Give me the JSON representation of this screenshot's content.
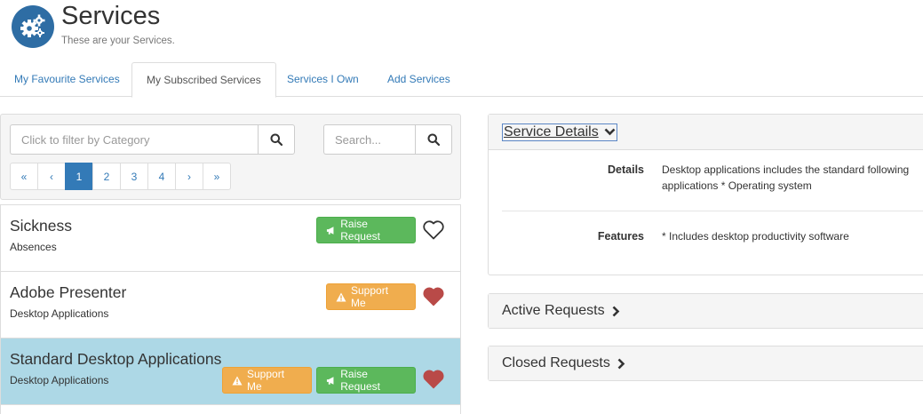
{
  "header": {
    "title": "Services",
    "subtitle": "These are your Services."
  },
  "tabs": [
    {
      "label": "My Favourite Services"
    },
    {
      "label": "My Subscribed Services"
    },
    {
      "label": "Services I Own"
    },
    {
      "label": "Add Services"
    }
  ],
  "filter": {
    "category_placeholder": "Click to filter by Category",
    "search_placeholder": "Search..."
  },
  "pagination": {
    "first": "«",
    "prev": "‹",
    "pages": [
      "1",
      "2",
      "3",
      "4"
    ],
    "current": "1",
    "next": "›",
    "last": "»"
  },
  "services": [
    {
      "name": "Sickness",
      "category": "Absences",
      "buttons": [
        "Raise Request"
      ],
      "favourite": false
    },
    {
      "name": "Adobe Presenter",
      "category": "Desktop Applications",
      "buttons": [
        "Support Me"
      ],
      "favourite": true
    },
    {
      "name": "Standard Desktop Applications",
      "category": "Desktop Applications",
      "buttons": [
        "Support Me",
        "Raise Request"
      ],
      "favourite": true,
      "selected": true
    }
  ],
  "labels": {
    "raise_request": "Raise Request",
    "support_me": "Support Me"
  },
  "details_panel": {
    "title": "Service Details",
    "details_label": "Details",
    "details_value": "Desktop applications includes the standard following applications * Operating system",
    "features_label": "Features",
    "features_value": "* Includes desktop productivity software"
  },
  "active_panel": {
    "title": "Active Requests"
  },
  "closed_panel": {
    "title": "Closed Requests"
  },
  "colors": {
    "primary": "#337ab7",
    "success": "#5cb85c",
    "warning": "#f0ad4e",
    "heart": "#b94a48",
    "selected_row": "#add8e6"
  }
}
